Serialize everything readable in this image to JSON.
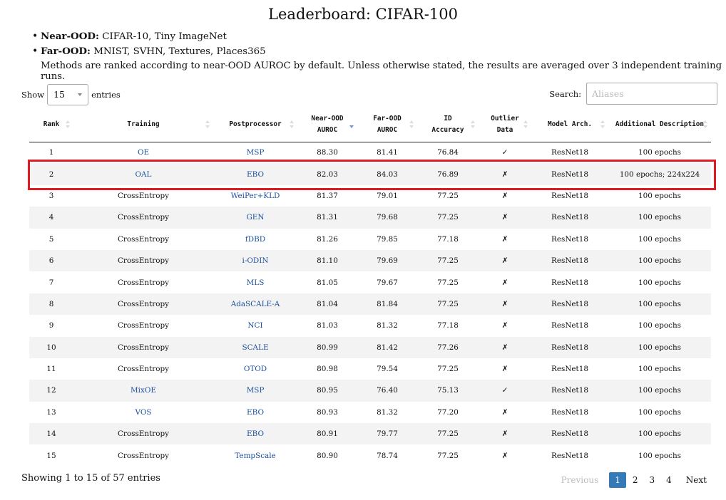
{
  "title": "Leaderboard: CIFAR-100",
  "bullets": [
    {
      "label": "Near-OOD:",
      "text": "CIFAR-10, Tiny ImageNet"
    },
    {
      "label": "Far-OOD:",
      "text": "MNIST, SVHN, Textures, Places365"
    }
  ],
  "note": "Methods are ranked according to near-OOD AUROC by default. Unless otherwise stated, the results are averaged over 3 independent training runs.",
  "length_control": {
    "show_label": "Show",
    "selected": "15",
    "entries_label": "entries"
  },
  "search": {
    "label": "Search:",
    "placeholder": "Aliases",
    "value": ""
  },
  "table": {
    "columns": [
      {
        "line1": "Rank",
        "line2": ""
      },
      {
        "line1": "Training",
        "line2": ""
      },
      {
        "line1": "Postprocessor",
        "line2": ""
      },
      {
        "line1": "Near-OOD",
        "line2": "AUROC"
      },
      {
        "line1": "Far-OOD",
        "line2": "AUROC"
      },
      {
        "line1": "ID",
        "line2": "Accuracy"
      },
      {
        "line1": "Outlier",
        "line2": "Data"
      },
      {
        "line1": "Model Arch.",
        "line2": ""
      },
      {
        "line1": "Additional Description",
        "line2": ""
      }
    ],
    "sorted_column": "Near-OOD AUROC",
    "sort_direction": "descending",
    "rows": [
      [
        "1",
        "OE",
        "MSP",
        "88.30",
        "81.41",
        "76.84",
        "✓",
        "ResNet18",
        "100 epochs"
      ],
      [
        "2",
        "OAL",
        "EBO",
        "82.03",
        "84.03",
        "76.89",
        "✗",
        "ResNet18",
        "100 epochs; 224x224"
      ],
      [
        "3",
        "CrossEntropy",
        "WeiPer+KLD",
        "81.37",
        "79.01",
        "77.25",
        "✗",
        "ResNet18",
        "100 epochs"
      ],
      [
        "4",
        "CrossEntropy",
        "GEN",
        "81.31",
        "79.68",
        "77.25",
        "✗",
        "ResNet18",
        "100 epochs"
      ],
      [
        "5",
        "CrossEntropy",
        "fDBD",
        "81.26",
        "79.85",
        "77.18",
        "✗",
        "ResNet18",
        "100 epochs"
      ],
      [
        "6",
        "CrossEntropy",
        "i-ODIN",
        "81.10",
        "79.69",
        "77.25",
        "✗",
        "ResNet18",
        "100 epochs"
      ],
      [
        "7",
        "CrossEntropy",
        "MLS",
        "81.05",
        "79.67",
        "77.25",
        "✗",
        "ResNet18",
        "100 epochs"
      ],
      [
        "8",
        "CrossEntropy",
        "AdaSCALE-A",
        "81.04",
        "81.84",
        "77.25",
        "✗",
        "ResNet18",
        "100 epochs"
      ],
      [
        "9",
        "CrossEntropy",
        "NCI",
        "81.03",
        "81.32",
        "77.18",
        "✗",
        "ResNet18",
        "100 epochs"
      ],
      [
        "10",
        "CrossEntropy",
        "SCALE",
        "80.99",
        "81.42",
        "77.26",
        "✗",
        "ResNet18",
        "100 epochs"
      ],
      [
        "11",
        "CrossEntropy",
        "OTOD",
        "80.98",
        "79.54",
        "77.25",
        "✗",
        "ResNet18",
        "100 epochs"
      ],
      [
        "12",
        "MixOE",
        "MSP",
        "80.95",
        "76.40",
        "75.13",
        "✓",
        "ResNet18",
        "100 epochs"
      ],
      [
        "13",
        "VOS",
        "EBO",
        "80.93",
        "81.32",
        "77.20",
        "✗",
        "ResNet18",
        "100 epochs"
      ],
      [
        "14",
        "CrossEntropy",
        "EBO",
        "80.91",
        "79.77",
        "77.25",
        "✗",
        "ResNet18",
        "100 epochs"
      ],
      [
        "15",
        "CrossEntropy",
        "TempScale",
        "80.90",
        "78.74",
        "77.25",
        "✗",
        "ResNet18",
        "100 epochs"
      ]
    ],
    "link_columns": [
      1,
      2
    ],
    "plain_training_values": [
      "CrossEntropy"
    ],
    "highlighted_row": 2
  },
  "info": "Showing 1 to 15 of 57 entries",
  "pagination": {
    "previous": "Previous",
    "pages": [
      "1",
      "2",
      "3",
      "4"
    ],
    "current": "1",
    "next": "Next"
  },
  "colors": {
    "link": "#1b4f9c",
    "highlight_border": "#e01a22",
    "current_page": "#337ab7",
    "stripe": "#f3f3f3"
  }
}
